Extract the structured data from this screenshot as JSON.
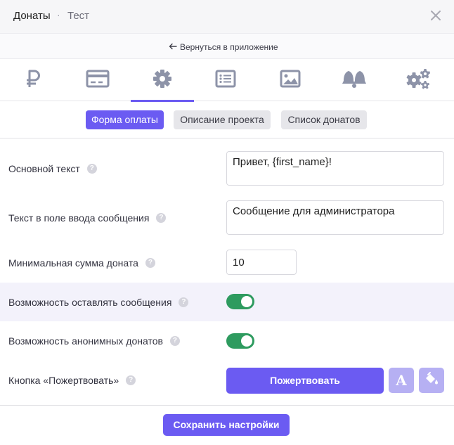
{
  "header": {
    "title": "Донаты",
    "separator": "·",
    "subtitle": "Тест",
    "close_icon": "close-icon"
  },
  "back_link": {
    "label": "Вернуться в приложение",
    "icon": "arrow-left-icon"
  },
  "tabs": [
    {
      "icon": "ruble-icon",
      "active": false
    },
    {
      "icon": "credit-card-icon",
      "active": false
    },
    {
      "icon": "gear-icon",
      "active": true
    },
    {
      "icon": "list-icon",
      "active": false
    },
    {
      "icon": "image-icon",
      "active": false
    },
    {
      "icon": "bells-icon",
      "active": false
    },
    {
      "icon": "gears-icon",
      "active": false
    }
  ],
  "subtabs": [
    {
      "label": "Форма оплаты",
      "active": true
    },
    {
      "label": "Описание проекта",
      "active": false
    },
    {
      "label": "Список донатов",
      "active": false
    }
  ],
  "fields": {
    "main_text": {
      "label": "Основной текст",
      "value": "Привет, {first_name}!"
    },
    "message_placeholder": {
      "label": "Текст в поле ввода сообщения",
      "value": "Сообщение для администратора"
    },
    "min_amount": {
      "label": "Минимальная сумма доната",
      "value": "10"
    },
    "allow_messages": {
      "label": "Возможность оставлять сообщения",
      "enabled": true
    },
    "allow_anonymous": {
      "label": "Возможность анонимных донатов",
      "enabled": true
    },
    "donate_button": {
      "label": "Кнопка «Пожертвовать»",
      "button_text": "Пожертвовать",
      "font_icon_letter": "A",
      "font_icon": "font-icon",
      "fill_icon": "paint-bucket-icon"
    }
  },
  "save_button": "Сохранить настройки",
  "colors": {
    "accent": "#6b5bf2",
    "accent_light": "#b6b0f3",
    "toggle_on": "#2e9b5f",
    "icon": "#8d93a8",
    "highlight_row": "#f3f2fb"
  }
}
